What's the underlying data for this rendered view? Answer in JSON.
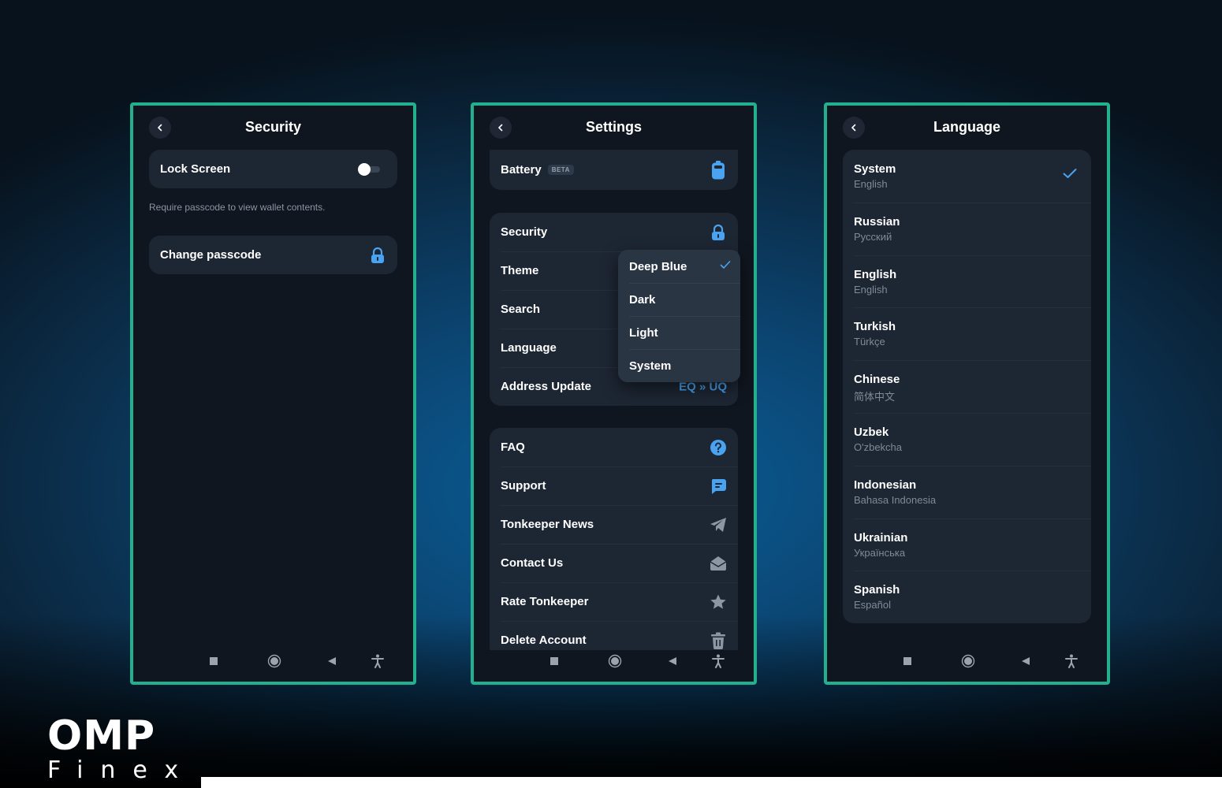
{
  "colors": {
    "accent": "#4aa3f0",
    "frame": "#23b08f",
    "card": "#1d2633",
    "screen": "#10161f"
  },
  "security": {
    "title": "Security",
    "back_icon": "chevron-left-icon",
    "lock_screen_label": "Lock Screen",
    "lock_screen_enabled": false,
    "lock_screen_hint": "Require passcode to view wallet contents.",
    "change_passcode_label": "Change passcode",
    "change_passcode_icon": "lock-icon"
  },
  "settings": {
    "title": "Settings",
    "battery_label": "Battery",
    "battery_badge": "BETA",
    "security_label": "Security",
    "theme_label": "Theme",
    "search_label": "Search",
    "language_label": "Language",
    "address_update_label": "Address Update",
    "address_update_value": "EQ » UQ",
    "theme_options": [
      "Deep Blue",
      "Dark",
      "Light",
      "System"
    ],
    "theme_selected": "Deep Blue",
    "faq_label": "FAQ",
    "support_label": "Support",
    "news_label": "Tonkeeper News",
    "contact_label": "Contact Us",
    "rate_label": "Rate Tonkeeper",
    "delete_label": "Delete Account"
  },
  "language": {
    "title": "Language",
    "selected": "System",
    "items": [
      {
        "name": "System",
        "native": "English"
      },
      {
        "name": "Russian",
        "native": "Русский"
      },
      {
        "name": "English",
        "native": "English"
      },
      {
        "name": "Turkish",
        "native": "Türkçe"
      },
      {
        "name": "Chinese",
        "native": "简体中文"
      },
      {
        "name": "Uzbek",
        "native": "O'zbekcha"
      },
      {
        "name": "Indonesian",
        "native": "Bahasa Indonesia"
      },
      {
        "name": "Ukrainian",
        "native": "Українська"
      },
      {
        "name": "Spanish",
        "native": "Español"
      }
    ]
  },
  "navbar": [
    "stop-icon",
    "home-circle-icon",
    "back-triangle-icon",
    "accessibility-icon"
  ],
  "logo": {
    "main": "OMP",
    "sub": "Finex"
  }
}
